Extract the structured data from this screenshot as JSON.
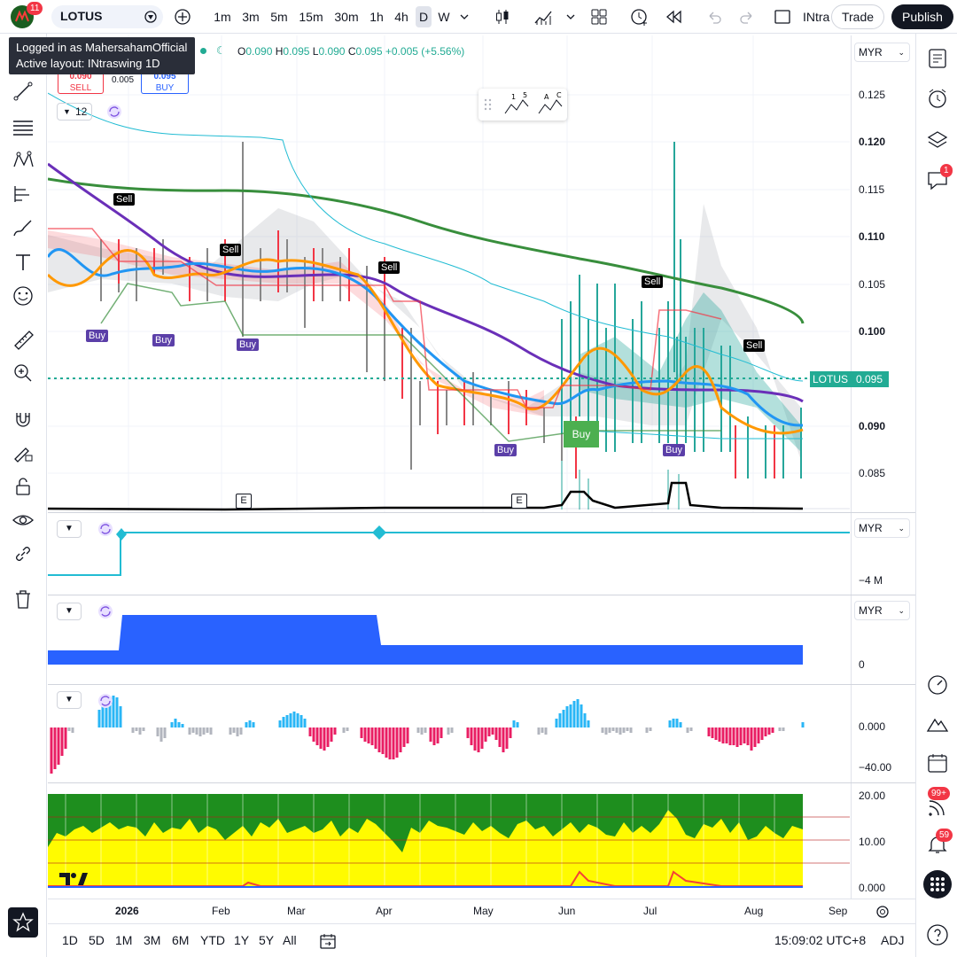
{
  "toolbar": {
    "logo_badge": "11",
    "symbol": "LOTUS",
    "intervals": [
      "1m",
      "3m",
      "5m",
      "15m",
      "30m",
      "1h",
      "4h",
      "D",
      "W"
    ],
    "active_interval": "D",
    "layout_name": "INtra",
    "trade_label": "Trade",
    "publish_label": "Publish"
  },
  "tooltip": {
    "line1": "Logged in as MahersahamOfficial",
    "line2": "Active layout: INtraswing 1D"
  },
  "legend": {
    "open_label": "O",
    "open": "0.090",
    "high_label": "H",
    "high": "0.095",
    "low_label": "L",
    "low": "0.090",
    "close_label": "C",
    "close": "0.095",
    "change": "+0.005 (+5.56%)"
  },
  "order": {
    "sell_price": "0.090",
    "sell_label": "SELL",
    "spread": "0.005",
    "buy_price": "0.095",
    "buy_label": "BUY"
  },
  "indicator_count": "12",
  "price_axis": {
    "currency": "MYR",
    "labels": [
      "0.125",
      "0.120",
      "0.115",
      "0.110",
      "0.105",
      "0.100",
      "0.090",
      "0.085"
    ],
    "current_symbol": "LOTUS",
    "current_price": "0.095"
  },
  "signals": {
    "sell": [
      "Sell",
      "Sell",
      "Sell",
      "Sell",
      "Sell"
    ],
    "buy": [
      "Buy",
      "Buy",
      "Buy",
      "Buy",
      "Buy",
      "Buy"
    ]
  },
  "earnings_marker": "E",
  "pane2": {
    "currency": "MYR",
    "label": "−4 M"
  },
  "pane3": {
    "currency": "MYR",
    "label": "0"
  },
  "pane4": {
    "labels": [
      "0.000",
      "−40.00"
    ]
  },
  "pane5": {
    "labels": [
      "20.00",
      "10.00",
      "0.000"
    ]
  },
  "time_axis": [
    "2026",
    "Feb",
    "Mar",
    "Apr",
    "May",
    "Jun",
    "Jul",
    "Aug",
    "Sep"
  ],
  "bottom": {
    "ranges": [
      "1D",
      "5D",
      "1M",
      "3M",
      "6M",
      "YTD",
      "1Y",
      "5Y",
      "All"
    ],
    "time": "15:09:02 UTC+8",
    "adj": "ADJ"
  },
  "right_badges": {
    "chat": "1",
    "ideas": "99+",
    "alerts": "59"
  },
  "colors": {
    "up": "#26a69a",
    "down": "#f23645",
    "accent": "#2962ff",
    "ma_long": "#388e3c",
    "ma_mid": "#6a2fb8",
    "ma_short": "#2196f3",
    "ma_fast": "#ff9800",
    "current_price_bg": "#22ab94"
  }
}
